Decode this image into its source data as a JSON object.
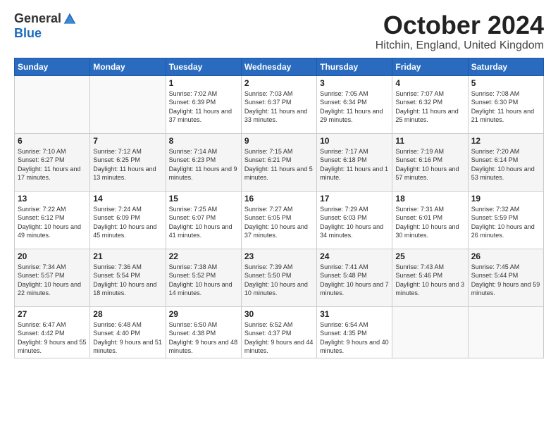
{
  "header": {
    "logo_general": "General",
    "logo_blue": "Blue",
    "month_title": "October 2024",
    "location": "Hitchin, England, United Kingdom"
  },
  "weekdays": [
    "Sunday",
    "Monday",
    "Tuesday",
    "Wednesday",
    "Thursday",
    "Friday",
    "Saturday"
  ],
  "weeks": [
    [
      {
        "day": "",
        "info": ""
      },
      {
        "day": "",
        "info": ""
      },
      {
        "day": "1",
        "info": "Sunrise: 7:02 AM\nSunset: 6:39 PM\nDaylight: 11 hours and 37 minutes."
      },
      {
        "day": "2",
        "info": "Sunrise: 7:03 AM\nSunset: 6:37 PM\nDaylight: 11 hours and 33 minutes."
      },
      {
        "day": "3",
        "info": "Sunrise: 7:05 AM\nSunset: 6:34 PM\nDaylight: 11 hours and 29 minutes."
      },
      {
        "day": "4",
        "info": "Sunrise: 7:07 AM\nSunset: 6:32 PM\nDaylight: 11 hours and 25 minutes."
      },
      {
        "day": "5",
        "info": "Sunrise: 7:08 AM\nSunset: 6:30 PM\nDaylight: 11 hours and 21 minutes."
      }
    ],
    [
      {
        "day": "6",
        "info": "Sunrise: 7:10 AM\nSunset: 6:27 PM\nDaylight: 11 hours and 17 minutes."
      },
      {
        "day": "7",
        "info": "Sunrise: 7:12 AM\nSunset: 6:25 PM\nDaylight: 11 hours and 13 minutes."
      },
      {
        "day": "8",
        "info": "Sunrise: 7:14 AM\nSunset: 6:23 PM\nDaylight: 11 hours and 9 minutes."
      },
      {
        "day": "9",
        "info": "Sunrise: 7:15 AM\nSunset: 6:21 PM\nDaylight: 11 hours and 5 minutes."
      },
      {
        "day": "10",
        "info": "Sunrise: 7:17 AM\nSunset: 6:18 PM\nDaylight: 11 hours and 1 minute."
      },
      {
        "day": "11",
        "info": "Sunrise: 7:19 AM\nSunset: 6:16 PM\nDaylight: 10 hours and 57 minutes."
      },
      {
        "day": "12",
        "info": "Sunrise: 7:20 AM\nSunset: 6:14 PM\nDaylight: 10 hours and 53 minutes."
      }
    ],
    [
      {
        "day": "13",
        "info": "Sunrise: 7:22 AM\nSunset: 6:12 PM\nDaylight: 10 hours and 49 minutes."
      },
      {
        "day": "14",
        "info": "Sunrise: 7:24 AM\nSunset: 6:09 PM\nDaylight: 10 hours and 45 minutes."
      },
      {
        "day": "15",
        "info": "Sunrise: 7:25 AM\nSunset: 6:07 PM\nDaylight: 10 hours and 41 minutes."
      },
      {
        "day": "16",
        "info": "Sunrise: 7:27 AM\nSunset: 6:05 PM\nDaylight: 10 hours and 37 minutes."
      },
      {
        "day": "17",
        "info": "Sunrise: 7:29 AM\nSunset: 6:03 PM\nDaylight: 10 hours and 34 minutes."
      },
      {
        "day": "18",
        "info": "Sunrise: 7:31 AM\nSunset: 6:01 PM\nDaylight: 10 hours and 30 minutes."
      },
      {
        "day": "19",
        "info": "Sunrise: 7:32 AM\nSunset: 5:59 PM\nDaylight: 10 hours and 26 minutes."
      }
    ],
    [
      {
        "day": "20",
        "info": "Sunrise: 7:34 AM\nSunset: 5:57 PM\nDaylight: 10 hours and 22 minutes."
      },
      {
        "day": "21",
        "info": "Sunrise: 7:36 AM\nSunset: 5:54 PM\nDaylight: 10 hours and 18 minutes."
      },
      {
        "day": "22",
        "info": "Sunrise: 7:38 AM\nSunset: 5:52 PM\nDaylight: 10 hours and 14 minutes."
      },
      {
        "day": "23",
        "info": "Sunrise: 7:39 AM\nSunset: 5:50 PM\nDaylight: 10 hours and 10 minutes."
      },
      {
        "day": "24",
        "info": "Sunrise: 7:41 AM\nSunset: 5:48 PM\nDaylight: 10 hours and 7 minutes."
      },
      {
        "day": "25",
        "info": "Sunrise: 7:43 AM\nSunset: 5:46 PM\nDaylight: 10 hours and 3 minutes."
      },
      {
        "day": "26",
        "info": "Sunrise: 7:45 AM\nSunset: 5:44 PM\nDaylight: 9 hours and 59 minutes."
      }
    ],
    [
      {
        "day": "27",
        "info": "Sunrise: 6:47 AM\nSunset: 4:42 PM\nDaylight: 9 hours and 55 minutes."
      },
      {
        "day": "28",
        "info": "Sunrise: 6:48 AM\nSunset: 4:40 PM\nDaylight: 9 hours and 51 minutes."
      },
      {
        "day": "29",
        "info": "Sunrise: 6:50 AM\nSunset: 4:38 PM\nDaylight: 9 hours and 48 minutes."
      },
      {
        "day": "30",
        "info": "Sunrise: 6:52 AM\nSunset: 4:37 PM\nDaylight: 9 hours and 44 minutes."
      },
      {
        "day": "31",
        "info": "Sunrise: 6:54 AM\nSunset: 4:35 PM\nDaylight: 9 hours and 40 minutes."
      },
      {
        "day": "",
        "info": ""
      },
      {
        "day": "",
        "info": ""
      }
    ]
  ]
}
